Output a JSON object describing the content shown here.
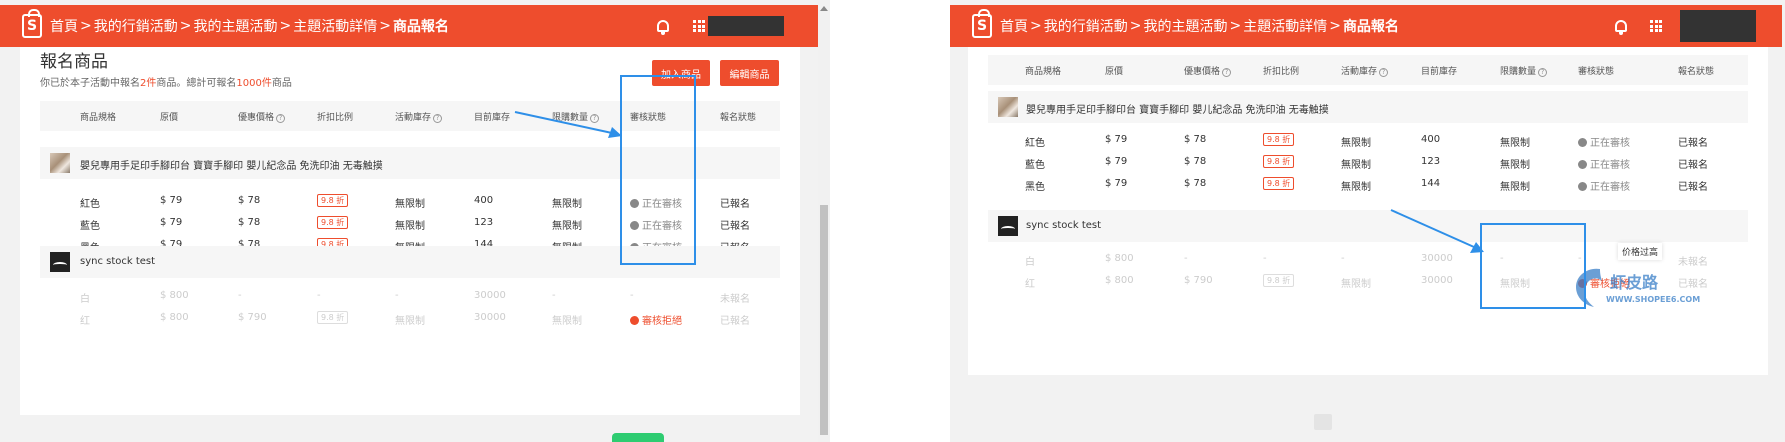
{
  "common": {
    "breadcrumb": [
      "首頁",
      "我的行銷活動",
      "我的主題活動",
      "主題活動詳情",
      "商品報名"
    ],
    "breadcrumb_separator": ">",
    "logo_letter": "S",
    "table_headers": [
      "商品規格",
      "原價",
      "優惠價格",
      "折扣比例",
      "活動庫存",
      "目前庫存",
      "限購數量",
      "審核狀態",
      "報名狀態"
    ],
    "product1": {
      "name": "嬰兒專用手足印手腳印台 寶寶手腳印 嬰儿紀念品 免洗印油 无毒触摸",
      "variants": [
        {
          "spec": "紅色",
          "price": "$ 79",
          "promo": "$ 78",
          "discount": "9.8 折",
          "activity_stock": "無限制",
          "current_stock": "400",
          "limit": "無限制",
          "review": "正在審核",
          "signup": "已報名"
        },
        {
          "spec": "藍色",
          "price": "$ 79",
          "promo": "$ 78",
          "discount": "9.8 折",
          "activity_stock": "無限制",
          "current_stock": "123",
          "limit": "無限制",
          "review": "正在審核",
          "signup": "已報名"
        },
        {
          "spec": "黑色",
          "price": "$ 79",
          "promo": "$ 78",
          "discount": "9.8 折",
          "activity_stock": "無限制",
          "current_stock": "144",
          "limit": "無限制",
          "review": "正在審核",
          "signup": "已報名"
        }
      ]
    },
    "product2": {
      "name": "sync stock test",
      "variants": [
        {
          "spec": "白",
          "price": "$ 800",
          "promo": "-",
          "discount": "-",
          "activity_stock": "-",
          "current_stock": "30000",
          "limit": "-",
          "review": "-",
          "signup": "未報名"
        },
        {
          "spec": "红",
          "price": "$ 800",
          "promo": "$ 790",
          "discount": "9.8 折",
          "activity_stock": "無限制",
          "current_stock": "30000",
          "limit": "無限制",
          "review": "審核拒絕",
          "signup": "已報名"
        }
      ]
    }
  },
  "left": {
    "section_title": "報名商品",
    "summary_prefix": "你已於本子活動中報名",
    "summary_count_products": "2件",
    "summary_middle": "商品。總計可報名",
    "summary_count_total": "1000件",
    "summary_suffix": "商品",
    "add_button": "加入商品",
    "edit_button": "編輯商品"
  },
  "right": {
    "tooltip": "价格过高",
    "watermark_cn": "虾皮路",
    "watermark_url": "WWW.SHOPEE6.COM"
  },
  "colors": {
    "brand": "#ee4d2d",
    "highlight": "#2e8fe8",
    "header_row": "#f6f6f6"
  },
  "icons": [
    "shopee-logo-icon",
    "bell-icon",
    "apps-grid-icon",
    "help-icon",
    "clock-icon",
    "reject-icon",
    "arrow-annotation"
  ]
}
